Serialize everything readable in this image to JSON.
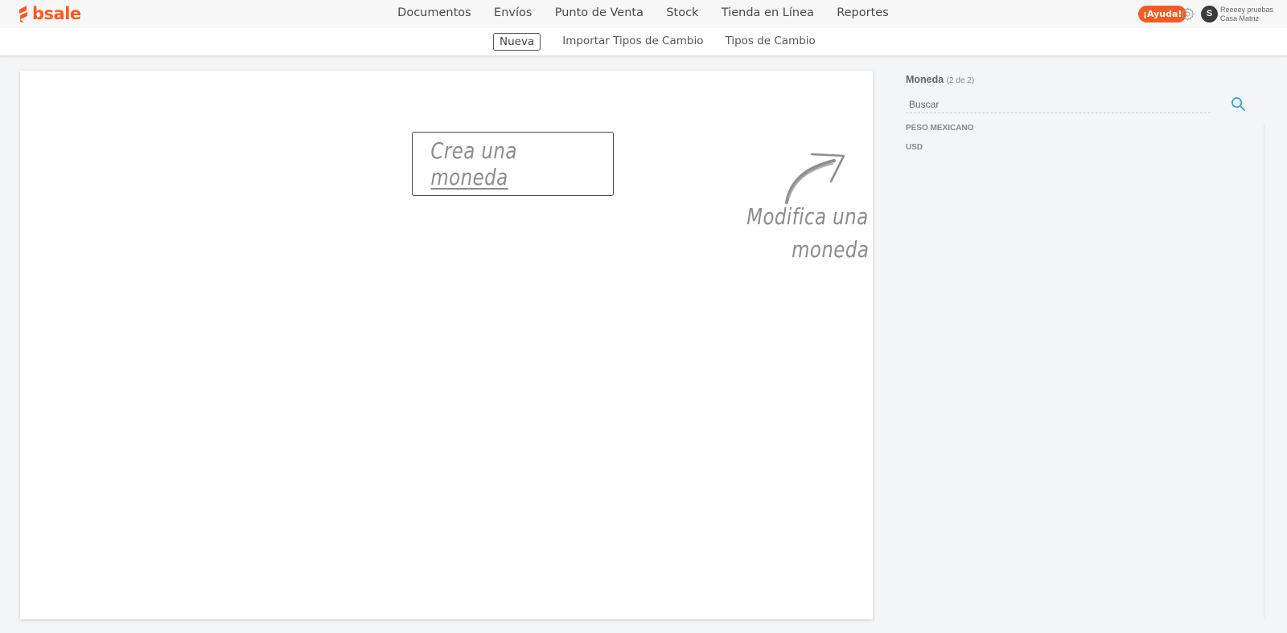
{
  "brand": {
    "name": "bsale",
    "color": "#ff5a1f"
  },
  "main_nav": [
    {
      "label": "Documentos"
    },
    {
      "label": "Envíos"
    },
    {
      "label": "Punto de Venta"
    },
    {
      "label": "Stock"
    },
    {
      "label": "Tienda en Línea"
    },
    {
      "label": "Reportes"
    }
  ],
  "header": {
    "help_label": "¡Ayuda!",
    "settings_icon": "gear-icon",
    "avatar_initial": "S",
    "user_name": "Reeeey pruebas",
    "user_branch": "Casa Matriz"
  },
  "sub_nav": {
    "active": "Nueva",
    "items": [
      {
        "label": "Nueva"
      },
      {
        "label": "Importar Tipos de Cambio"
      },
      {
        "label": "Tipos de Cambio"
      }
    ]
  },
  "main": {
    "create_prefix": "Crea una ",
    "create_link": "moneda",
    "modify_line1": "Modifica una",
    "modify_line2": "moneda"
  },
  "panel": {
    "title": "Moneda",
    "count": "(2 de 2)",
    "search_placeholder": "Buscar",
    "search_icon": "search-icon",
    "items": [
      {
        "label": "PESO MEXICANO"
      },
      {
        "label": "USD"
      }
    ]
  },
  "colors": {
    "accent": "#f25c22",
    "nav_underline": "#f8b38f",
    "search_icon": "#2aa0d8"
  }
}
